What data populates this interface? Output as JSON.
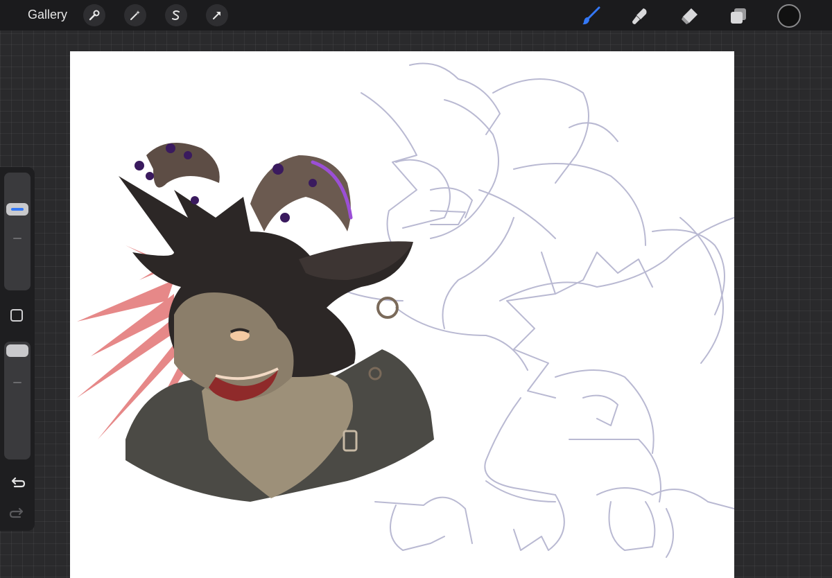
{
  "topbar": {
    "gallery_label": "Gallery",
    "left_tools": [
      "wrench-icon",
      "magic-wand-icon",
      "selection-s-icon",
      "transform-arrow-icon"
    ],
    "right_tools": [
      "brush-icon",
      "smudge-icon",
      "eraser-icon",
      "layers-icon"
    ],
    "active_tool": "brush-icon",
    "current_color": "#111111",
    "accent_color": "#3478f6"
  },
  "sidebar": {
    "controls": [
      "brush-size-slider",
      "modify-button",
      "opacity-slider",
      "undo-icon",
      "redo-icon"
    ]
  },
  "canvas": {
    "background": "#ffffff",
    "content": "character-illustration-with-sketches"
  }
}
